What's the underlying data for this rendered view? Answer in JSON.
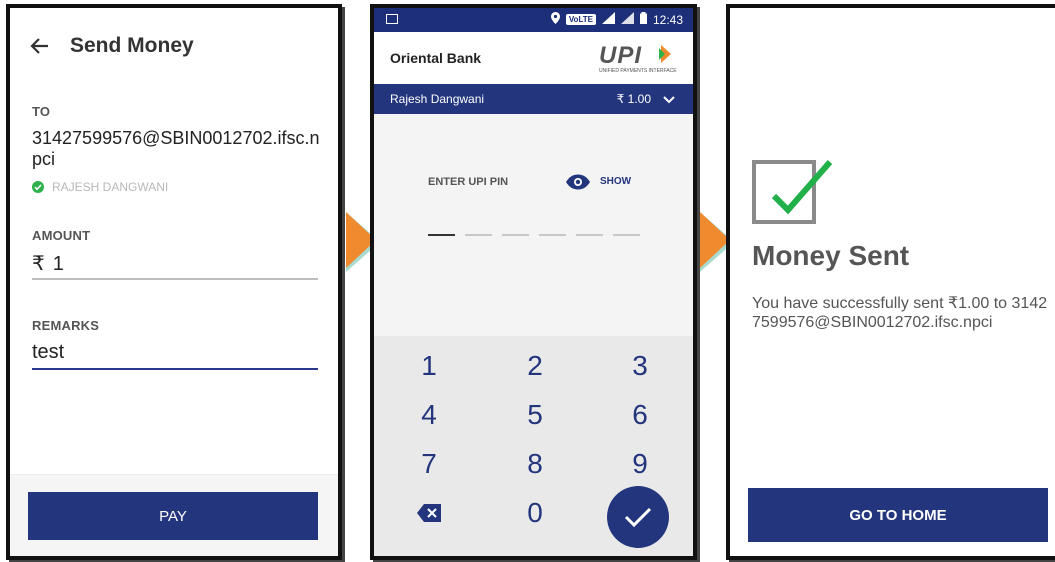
{
  "send_money": {
    "title": "Send Money",
    "to_label": "TO",
    "to_value": "31427599576@SBIN0012702.ifsc.npci",
    "payee_verified": "RAJESH DANGWANI",
    "amount_label": "AMOUNT",
    "currency_symbol": "₹",
    "amount_value": "1",
    "remarks_label": "REMARKS",
    "remarks_value": "test",
    "pay_label": "PAY"
  },
  "upi_pin": {
    "status_time": "12:43",
    "status_network": "VoLTE",
    "bank_name": "Oriental Bank",
    "upi_logo": "UPI",
    "upi_logo_sub": "UNIFIED PAYMENTS INTERFACE",
    "payee_name": "Rajesh Dangwani",
    "amount": "₹ 1.00",
    "enter_pin_label": "ENTER UPI PIN",
    "show_label": "SHOW",
    "pin_length": 6,
    "keys": [
      "1",
      "2",
      "3",
      "4",
      "5",
      "6",
      "7",
      "8",
      "9",
      "0"
    ]
  },
  "success": {
    "title": "Money Sent",
    "message": "You have successfully sent ₹1.00 to 31427599576@SBIN0012702.ifsc.npci",
    "home_label": "GO TO HOME"
  },
  "colors": {
    "primary": "#23357d",
    "status_bar": "#1d2f78",
    "verified_green": "#2eb04a",
    "check_green": "#22b04a",
    "arrow_orange": "#ef8a2e",
    "arrow_shadow": "#a8dcd0"
  }
}
